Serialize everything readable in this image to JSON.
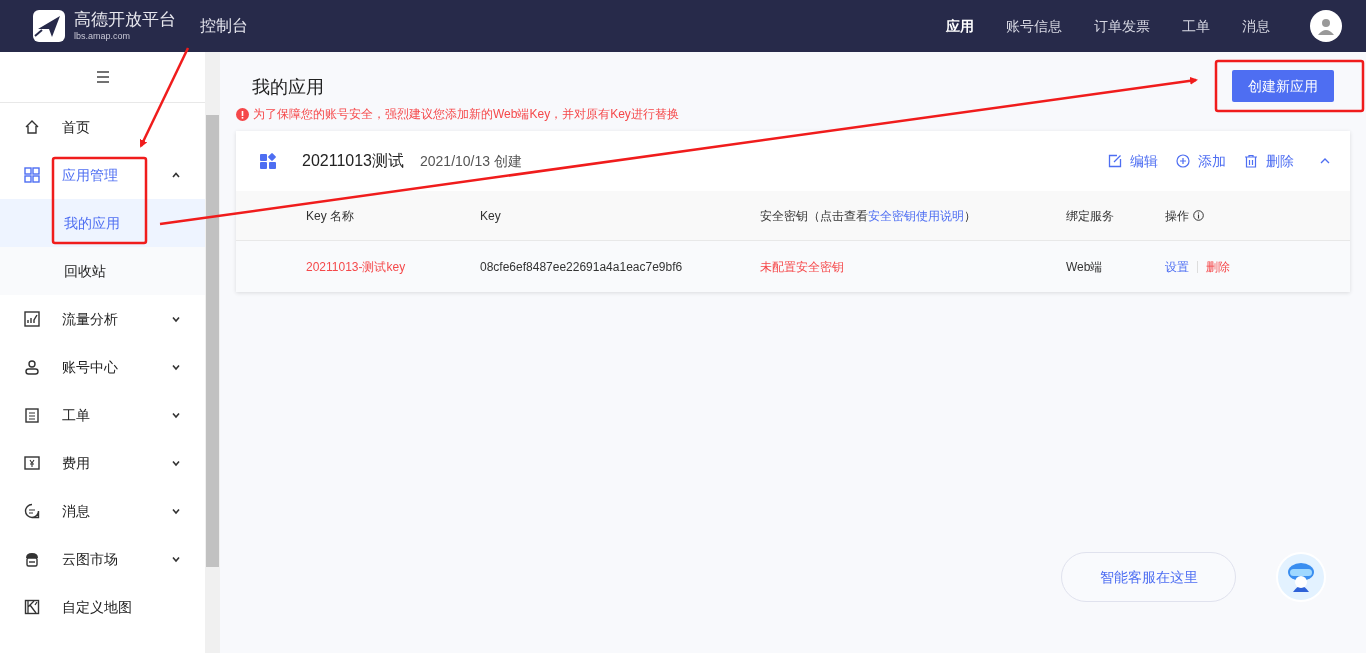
{
  "header": {
    "logo_name": "高德开放平台",
    "logo_url": "lbs.amap.com",
    "console": "控制台",
    "nav": [
      {
        "label": "应用",
        "selected": true
      },
      {
        "label": "账号信息",
        "selected": false
      },
      {
        "label": "订单发票",
        "selected": false
      },
      {
        "label": "工单",
        "selected": false
      },
      {
        "label": "消息",
        "selected": false
      }
    ]
  },
  "sidebar": {
    "items": [
      {
        "label": "首页",
        "kind": "link",
        "selected": false
      },
      {
        "label": "应用管理",
        "kind": "group",
        "expanded": true,
        "selected": true,
        "children": [
          {
            "label": "我的应用",
            "selected": true
          },
          {
            "label": "回收站",
            "selected": false
          }
        ]
      },
      {
        "label": "流量分析",
        "kind": "group",
        "expanded": false,
        "selected": false
      },
      {
        "label": "账号中心",
        "kind": "group",
        "expanded": false,
        "selected": false
      },
      {
        "label": "工单",
        "kind": "group",
        "expanded": false,
        "selected": false
      },
      {
        "label": "费用",
        "kind": "group",
        "expanded": false,
        "selected": false
      },
      {
        "label": "消息",
        "kind": "group",
        "expanded": false,
        "selected": false
      },
      {
        "label": "云图市场",
        "kind": "group",
        "expanded": false,
        "selected": false
      },
      {
        "label": "自定义地图",
        "kind": "link",
        "selected": false
      }
    ]
  },
  "main": {
    "title": "我的应用",
    "warning": "为了保障您的账号安全，强烈建议您添加新的Web端Key，并对原有Key进行替换",
    "create_button": "创建新应用",
    "app": {
      "name": "20211013测试",
      "created": "2021/10/13 创建",
      "expanded": true,
      "actions": [
        {
          "label": "编辑"
        },
        {
          "label": "添加"
        },
        {
          "label": "删除"
        }
      ],
      "table": {
        "columns": [
          {
            "label": "Key 名称"
          },
          {
            "label": "Key"
          },
          {
            "label": "安全密钥（点击查看",
            "link": "安全密钥使用说明",
            "suffix": "）"
          },
          {
            "label": "绑定服务"
          },
          {
            "label": "操作",
            "info": true
          }
        ],
        "rows": [
          {
            "key_name": "20211013-测试key",
            "key": "08cfe6ef8487ee22691a4a1eac7e9bf6",
            "secret": "未配置安全密钥",
            "service": "Web端",
            "actions": [
              {
                "label": "设置",
                "danger": false
              },
              {
                "label": "删除",
                "danger": true
              }
            ]
          }
        ]
      }
    }
  },
  "assistant": {
    "label": "智能客服在这里"
  }
}
